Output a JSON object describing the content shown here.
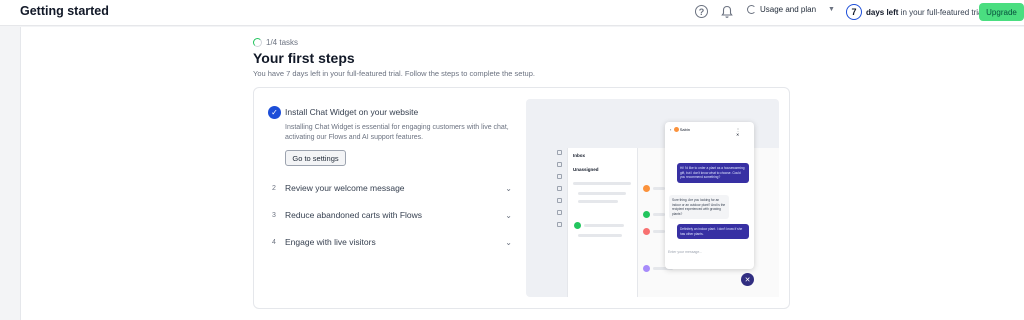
{
  "header": {
    "title": "Getting started",
    "help_icon": "?",
    "usage_label": "Usage and plan",
    "trial_days": "7",
    "trial_bold": "days left",
    "trial_rest": " in your full-featured trial",
    "upgrade_label": "Upgrade"
  },
  "setup": {
    "progress": "1/4 tasks",
    "title": "Your first steps",
    "subtitle": "You have 7 days left in your full-featured trial. Follow the steps to complete the setup."
  },
  "tasks": [
    {
      "number": "✓",
      "title": "Install Chat Widget on your website",
      "description": "Installing Chat Widget is essential for engaging customers with live chat, activating our Flows and AI support features.",
      "button": "Go to settings",
      "done": true
    },
    {
      "number": "2",
      "title": "Review your welcome message"
    },
    {
      "number": "3",
      "title": "Reduce abandoned carts with Flows"
    },
    {
      "number": "4",
      "title": "Engage with live visitors"
    }
  ],
  "preview": {
    "inbox_title": "Inbox",
    "unassigned": "Unassigned",
    "chat_name": "Sabin",
    "messages": [
      "Hi! I'd like to order a plant as a housewarming gift, but I don't know what to choose. Could you recommend something?",
      "Sure thing. Are you looking for an indoor or an outdoor plant? And is the recipient experienced with growing plants?",
      "Definitely an indoor plant. I don't know if she has other plants."
    ],
    "input_placeholder": "Enter your message..."
  },
  "colors": {
    "accent": "#1d4ed8",
    "upgrade": "#4ade80",
    "chat_bubble": "#3730a3"
  }
}
